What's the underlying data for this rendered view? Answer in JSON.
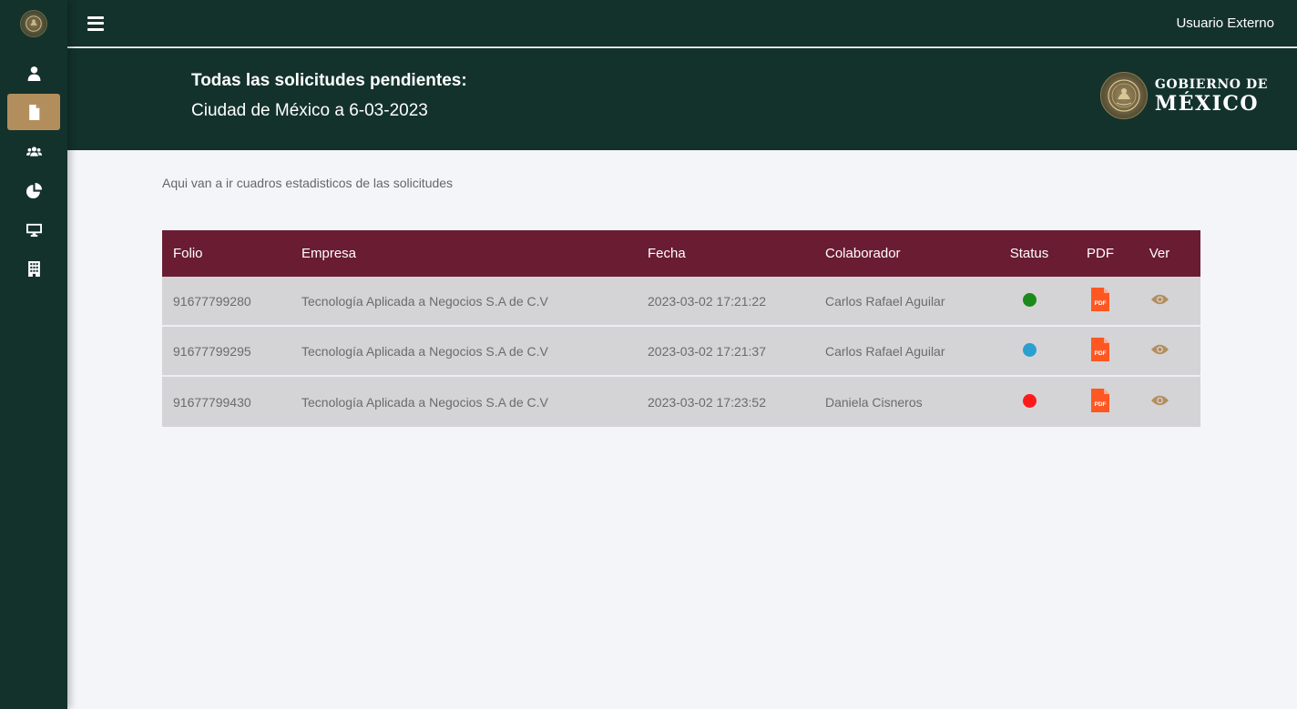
{
  "topbar": {
    "user_label": "Usuario Externo"
  },
  "sidebar": {
    "items": [
      {
        "icon": "user-icon",
        "active": false
      },
      {
        "icon": "document-icon",
        "active": true
      },
      {
        "icon": "users-icon",
        "active": false
      },
      {
        "icon": "pie-chart-icon",
        "active": false
      },
      {
        "icon": "desktop-icon",
        "active": false
      },
      {
        "icon": "building-icon",
        "active": false
      }
    ]
  },
  "header": {
    "title": "Todas las solicitudes pendientes:",
    "subtitle": "Ciudad de México a 6-03-2023",
    "logo_line1": "GOBIERNO DE",
    "logo_line2": "MÉXICO"
  },
  "main": {
    "intro": "Aqui van a ir cuadros estadisticos de las solicitudes"
  },
  "table": {
    "headers": {
      "folio": "Folio",
      "empresa": "Empresa",
      "fecha": "Fecha",
      "colaborador": "Colaborador",
      "status": "Status",
      "pdf": "PDF",
      "ver": "Ver"
    },
    "rows": [
      {
        "folio": "91677799280",
        "empresa": "Tecnología Aplicada a Negocios S.A de C.V",
        "fecha": "2023-03-02 17:21:22",
        "colaborador": "Carlos Rafael Aguilar",
        "status_color": "#1b8a1b"
      },
      {
        "folio": "91677799295",
        "empresa": "Tecnología Aplicada a Negocios S.A de C.V",
        "fecha": "2023-03-02 17:21:37",
        "colaborador": "Carlos Rafael Aguilar",
        "status_color": "#2a9fd0"
      },
      {
        "folio": "91677799430",
        "empresa": "Tecnología Aplicada a Negocios S.A de C.V",
        "fecha": "2023-03-02 17:23:52",
        "colaborador": "Daniela Cisneros",
        "status_color": "#ff1a1a"
      }
    ]
  },
  "colors": {
    "brand_dark_green": "#13322b",
    "brand_gold": "#b38e5d",
    "brand_wine": "#691c32",
    "pdf_orange": "#ff5722"
  }
}
